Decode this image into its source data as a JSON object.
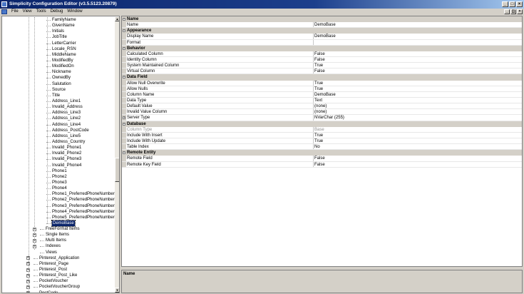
{
  "window": {
    "title": "Simplicity Configuration Editor (v3.5.5123.20879)",
    "btn_min": "_",
    "btn_max": "□",
    "btn_close": "×"
  },
  "menu": [
    "File",
    "View",
    "Tools",
    "Debug",
    "Window"
  ],
  "mdi": {
    "btn_min": "_",
    "btn_restore": "◫",
    "btn_close": "×"
  },
  "tree": {
    "fields": [
      "FamilyName",
      "GivenName",
      "Initials",
      "JobTitle",
      "LetterCarrier",
      "Locale_RSN",
      "MiddleName",
      "ModifiedBy",
      "ModifiedOn",
      "Nickname",
      "OwnedBy",
      "Salutation",
      "Source",
      "Title",
      "Address_Line1",
      "Invalid_Address",
      "Address_Line3",
      "Address_Line2",
      "Address_Line4",
      "Address_PostCode",
      "Address_Line5",
      "Address_Country",
      "Invalid_Phone1",
      "Invalid_Phone2",
      "Invalid_Phone3",
      "Invalid_Phone4",
      "Phone1",
      "Phone2",
      "Phone3",
      "Phone4",
      "Phone1_PreferredPhoneNumber",
      "Phone2_PreferredPhoneNumber",
      "Phone3_PreferredPhoneNumber",
      "Phone4_PreferredPhoneNumber",
      "Phone5_PreferredPhoneNumber",
      "DemoBase"
    ],
    "selected": "DemoBase",
    "groups": [
      "FreeFormat Items",
      "Single Items",
      "Multi Items",
      "Indexes",
      "Views"
    ],
    "entities": [
      "Pinterest_Application",
      "Pinterest_Page",
      "Pinterest_Post",
      "Pinterest_Post_Like",
      "PocketVoucher",
      "PocketVoucherGroup",
      "PostCode"
    ],
    "expander_plus": "+"
  },
  "grid": {
    "toggle_symbol": "−",
    "expand_symbol": "+",
    "sections": [
      {
        "category": "Name",
        "rows": [
          {
            "name": "Name",
            "value": "DemoBase"
          }
        ]
      },
      {
        "category": "Appearance",
        "rows": [
          {
            "name": "Display Name",
            "value": "DemoBase"
          },
          {
            "name": "Format",
            "value": ""
          }
        ]
      },
      {
        "category": "Behavior",
        "rows": [
          {
            "name": "Calculated Column",
            "value": "False"
          },
          {
            "name": "Identity Column",
            "value": "False"
          },
          {
            "name": "System Maintained Column",
            "value": "True"
          },
          {
            "name": "Virtual Column",
            "value": "False"
          }
        ]
      },
      {
        "category": "Data Field",
        "rows": [
          {
            "name": "Allow Null Overwrite",
            "value": "True"
          },
          {
            "name": "Allow Nulls",
            "value": "True"
          },
          {
            "name": "Column Name",
            "value": "DemoBase"
          },
          {
            "name": "Data Type",
            "value": "Text"
          },
          {
            "name": "Default Value",
            "value": "(none)"
          },
          {
            "name": "Invalid Value Column",
            "value": "(none)"
          },
          {
            "name": "Server Type",
            "value": "NVarChar (255)"
          }
        ]
      },
      {
        "category": "Database",
        "rows": [
          {
            "name": "Column Type",
            "value": "Base"
          },
          {
            "name": "Include With Insert",
            "value": "True"
          },
          {
            "name": "Include With Update",
            "value": "True"
          },
          {
            "name": "Table Index",
            "value": "No"
          }
        ]
      },
      {
        "category": "Remote Entity",
        "rows": [
          {
            "name": "Remote Field",
            "value": "False"
          },
          {
            "name": "Remote Key Field",
            "value": "False"
          }
        ]
      }
    ]
  },
  "description": {
    "title": "Name"
  },
  "scroll": {
    "up": "▲",
    "down": "▼"
  }
}
